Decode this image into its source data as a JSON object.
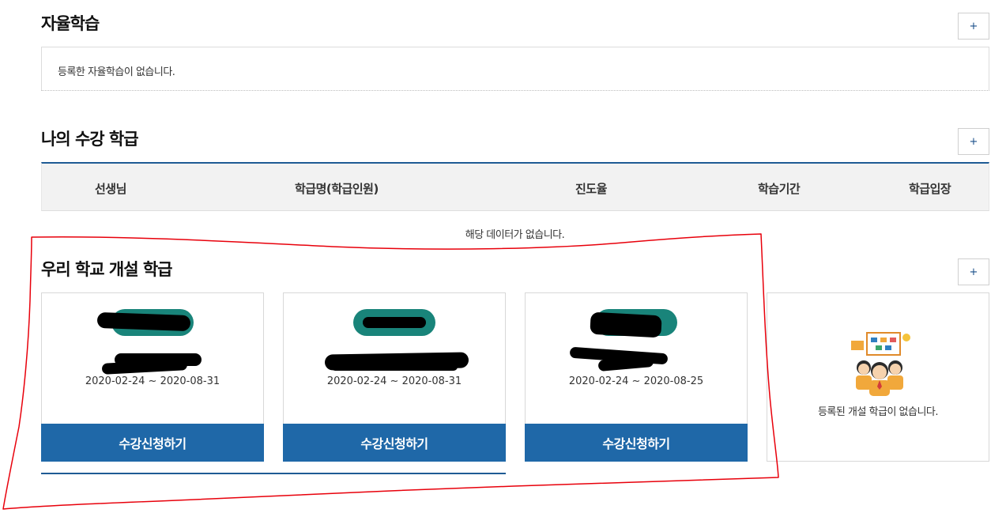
{
  "self_study": {
    "title": "자율학습",
    "plus": "+",
    "empty_msg": "등록한 자율학습이 없습니다."
  },
  "my_classes": {
    "title": "나의 수강 학급",
    "plus": "+",
    "columns": [
      "선생님",
      "학급명(학급인원)",
      "진도율",
      "학습기간",
      "학급입장"
    ],
    "empty_msg": "해당 데이터가 없습니다."
  },
  "school_classes": {
    "title": "우리 학교 개설 학급",
    "plus": "+",
    "cards": [
      {
        "period": "2020-02-24 ~ 2020-08-31",
        "button": "수강신청하기"
      },
      {
        "period": "2020-02-24 ~ 2020-08-31",
        "button": "수강신청하기"
      },
      {
        "period": "2020-02-24 ~ 2020-08-25",
        "button": "수강신청하기"
      }
    ],
    "empty_msg": "등록된 개설 학급이 없습니다."
  },
  "colors": {
    "accent": "#1f68a8",
    "badge": "#19847a",
    "annotation": "#e8000b"
  }
}
